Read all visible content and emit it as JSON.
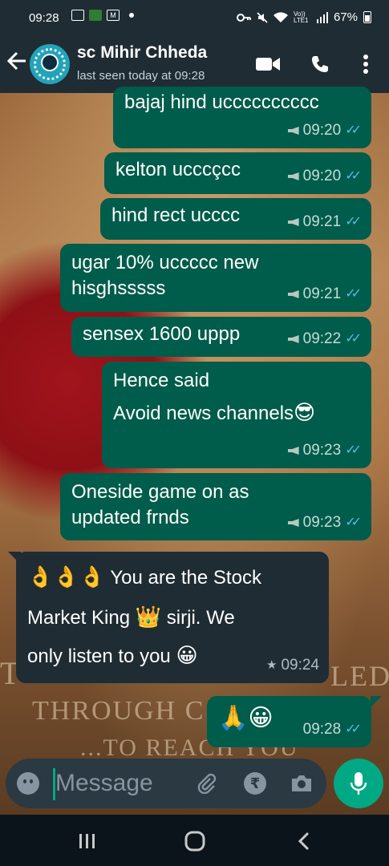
{
  "status_bar": {
    "time": "09:28",
    "battery": "67%",
    "network": "Vo)) LTE1"
  },
  "header": {
    "contact_name": "sc Mihir Chheda",
    "last_seen": "last seen today at 09:28"
  },
  "messages": [
    {
      "dir": "out",
      "text": "bajaj hind ucccccccccc",
      "time": "09:20"
    },
    {
      "dir": "out",
      "text": "kelton ucccçcc",
      "time": "09:20"
    },
    {
      "dir": "out",
      "text": "hind rect ucccc",
      "time": "09:21"
    },
    {
      "dir": "out",
      "line1": "ugar 10% uccccc new",
      "line2": "hisghsssss",
      "time": "09:21"
    },
    {
      "dir": "out",
      "text": "sensex 1600 uppp",
      "time": "09:22"
    },
    {
      "dir": "out",
      "line1": "Hence said",
      "line2": "Avoid news channels",
      "emoji": "😎",
      "time": "09:23"
    },
    {
      "dir": "out",
      "line1": "Oneside game on as",
      "line2": "updated frnds",
      "time": "09:23"
    },
    {
      "dir": "in",
      "emoji1": "👌👌👌",
      "line1": "You are the Stock",
      "line2a": "Market King",
      "emoji2": "👑",
      "line2b": "sirji. We",
      "line3": "only listen to you",
      "emoji3": "😀",
      "time": "09:24",
      "star": "★"
    },
    {
      "dir": "out",
      "emoji": "🙏😀",
      "time": "09:28"
    }
  ],
  "input": {
    "placeholder": "Message",
    "currency_symbol": "₹"
  },
  "wallpaper_text": {
    "line1": "THROUGH C",
    "line2": "...TO REACH YOU",
    "left_fragment": "T",
    "right_fragment": "LED"
  },
  "colors": {
    "outgoing_bubble": "#005c4b",
    "incoming_bubble": "#1f2c34",
    "accent": "#00a884",
    "ticks": "#53bdeb"
  }
}
